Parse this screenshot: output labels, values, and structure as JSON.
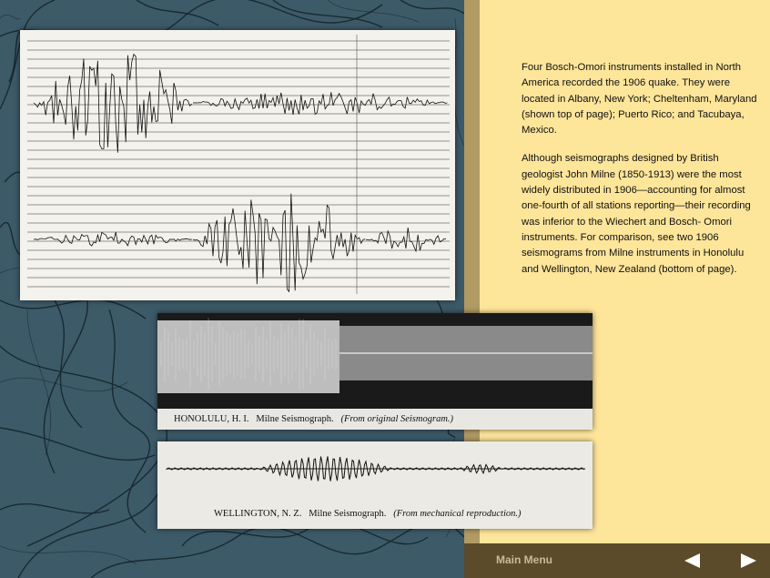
{
  "text": {
    "paragraph1": "Four Bosch-Omori instruments installed in North America recorded the 1906 quake. They were located in Albany, New York; Cheltenham, Maryland (shown top of page); Puerto Rico; and Tacubaya, Mexico.",
    "paragraph2": "Although seismographs designed by British geologist John Milne (1850-1913) were the most widely distributed in 1906—accounting for almost one-fourth of all stations reporting—their recording was inferior to the Wiechert and Bosch- Omori instruments. For comparison, see two 1906 seismograms from Milne instruments in Honolulu and Wellington, New Zealand (bottom of page)."
  },
  "figures": {
    "honolulu": {
      "place": "HONOLULU, H. I.",
      "instrument": "Milne Seismograph.",
      "note": "(From original Seismogram.)"
    },
    "wellington": {
      "place": "WELLINGTON, N. Z.",
      "instrument": "Milne Seismograph.",
      "note": "(From mechanical reproduction.)"
    }
  },
  "nav": {
    "main_menu": "Main Menu",
    "prev_icon": "left-triangle-arrow",
    "next_icon": "right-triangle-arrow"
  },
  "colors": {
    "left_bg": "#3d5a68",
    "right_panel": "#fde59a",
    "divider": "#b19b63",
    "bottom_bar": "#5b4b2a"
  }
}
